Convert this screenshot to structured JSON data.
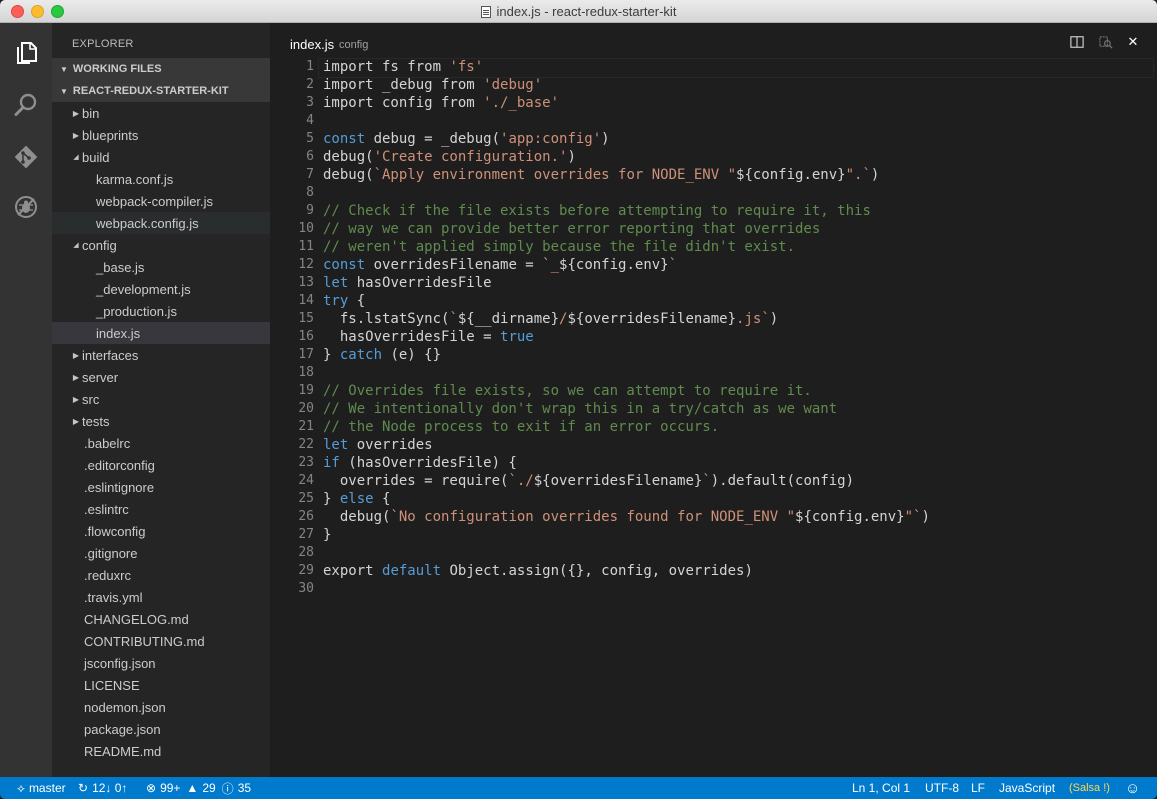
{
  "window": {
    "title": "index.js - react-redux-starter-kit"
  },
  "activity_bar": [
    {
      "name": "explorer-icon"
    },
    {
      "name": "search-icon"
    },
    {
      "name": "git-icon"
    },
    {
      "name": "debug-icon"
    }
  ],
  "sidebar": {
    "title": "EXPLORER",
    "working_files": "WORKING FILES",
    "project": "REACT-REDUX-STARTER-KIT",
    "tree": [
      {
        "label": "bin",
        "kind": "folder-collapsed",
        "depth": 1
      },
      {
        "label": "blueprints",
        "kind": "folder-collapsed",
        "depth": 1
      },
      {
        "label": "build",
        "kind": "folder-expanded",
        "depth": 1
      },
      {
        "label": "karma.conf.js",
        "kind": "file",
        "depth": 2
      },
      {
        "label": "webpack-compiler.js",
        "kind": "file",
        "depth": 2
      },
      {
        "label": "webpack.config.js",
        "kind": "file",
        "depth": 2,
        "state": "hover"
      },
      {
        "label": "config",
        "kind": "folder-expanded",
        "depth": 1
      },
      {
        "label": "_base.js",
        "kind": "file",
        "depth": 2
      },
      {
        "label": "_development.js",
        "kind": "file",
        "depth": 2
      },
      {
        "label": "_production.js",
        "kind": "file",
        "depth": 2
      },
      {
        "label": "index.js",
        "kind": "file",
        "depth": 2,
        "state": "selected"
      },
      {
        "label": "interfaces",
        "kind": "folder-collapsed",
        "depth": 1
      },
      {
        "label": "server",
        "kind": "folder-collapsed",
        "depth": 1
      },
      {
        "label": "src",
        "kind": "folder-collapsed",
        "depth": 1
      },
      {
        "label": "tests",
        "kind": "folder-collapsed",
        "depth": 1
      },
      {
        "label": ".babelrc",
        "kind": "file",
        "depth": 1
      },
      {
        "label": ".editorconfig",
        "kind": "file",
        "depth": 1
      },
      {
        "label": ".eslintignore",
        "kind": "file",
        "depth": 1
      },
      {
        "label": ".eslintrc",
        "kind": "file",
        "depth": 1
      },
      {
        "label": ".flowconfig",
        "kind": "file",
        "depth": 1
      },
      {
        "label": ".gitignore",
        "kind": "file",
        "depth": 1
      },
      {
        "label": ".reduxrc",
        "kind": "file",
        "depth": 1
      },
      {
        "label": ".travis.yml",
        "kind": "file",
        "depth": 1
      },
      {
        "label": "CHANGELOG.md",
        "kind": "file",
        "depth": 1
      },
      {
        "label": "CONTRIBUTING.md",
        "kind": "file",
        "depth": 1
      },
      {
        "label": "jsconfig.json",
        "kind": "file",
        "depth": 1
      },
      {
        "label": "LICENSE",
        "kind": "file",
        "depth": 1
      },
      {
        "label": "nodemon.json",
        "kind": "file",
        "depth": 1
      },
      {
        "label": "package.json",
        "kind": "file",
        "depth": 1
      },
      {
        "label": "README.md",
        "kind": "file",
        "depth": 1
      }
    ]
  },
  "editor": {
    "tab": {
      "name": "index.js",
      "description": "config"
    },
    "actions": [
      {
        "name": "split-editor-icon",
        "glyph": "◫"
      },
      {
        "name": "open-changes-icon",
        "glyph": "⧉"
      },
      {
        "name": "close-icon",
        "glyph": "✕"
      }
    ],
    "lines": [
      [
        [
          "",
          "import fs from "
        ],
        [
          "s",
          "'fs'"
        ]
      ],
      [
        [
          "",
          "import _debug from "
        ],
        [
          "s",
          "'debug'"
        ]
      ],
      [
        [
          "",
          "import config from "
        ],
        [
          "s",
          "'./_base'"
        ]
      ],
      [],
      [
        [
          "k",
          "const"
        ],
        [
          "",
          " debug = _debug("
        ],
        [
          "s",
          "'app:config'"
        ],
        [
          "",
          ")"
        ]
      ],
      [
        [
          "",
          "debug("
        ],
        [
          "s",
          "'Create configuration.'"
        ],
        [
          "",
          ")"
        ]
      ],
      [
        [
          "",
          "debug("
        ],
        [
          "s",
          "`Apply environment overrides for NODE_ENV \""
        ],
        [
          "",
          "${config.env}"
        ],
        [
          "s",
          "\".`"
        ],
        [
          "",
          ")"
        ]
      ],
      [],
      [
        [
          "c",
          "// Check if the file exists before attempting to require it, this"
        ]
      ],
      [
        [
          "c",
          "// way we can provide better error reporting that overrides"
        ]
      ],
      [
        [
          "c",
          "// weren't applied simply because the file didn't exist."
        ]
      ],
      [
        [
          "k",
          "const"
        ],
        [
          "",
          " overridesFilename = "
        ],
        [
          "s",
          "`_"
        ],
        [
          "",
          "${config.env}"
        ],
        [
          "s",
          "`"
        ]
      ],
      [
        [
          "k",
          "let"
        ],
        [
          "",
          " hasOverridesFile"
        ]
      ],
      [
        [
          "k",
          "try"
        ],
        [
          "",
          " {"
        ]
      ],
      [
        [
          "",
          "  fs.lstatSync("
        ],
        [
          "s",
          "`"
        ],
        [
          "",
          "${__dirname}"
        ],
        [
          "s",
          "/"
        ],
        [
          "",
          "${overridesFilename}"
        ],
        [
          "s",
          ".js`"
        ],
        [
          "",
          ")"
        ]
      ],
      [
        [
          "",
          "  hasOverridesFile = "
        ],
        [
          "k",
          "true"
        ]
      ],
      [
        [
          "",
          "} "
        ],
        [
          "k",
          "catch"
        ],
        [
          "",
          " (e) {}"
        ]
      ],
      [],
      [
        [
          "c",
          "// Overrides file exists, so we can attempt to require it."
        ]
      ],
      [
        [
          "c",
          "// We intentionally don't wrap this in a try/catch as we want"
        ]
      ],
      [
        [
          "c",
          "// the Node process to exit if an error occurs."
        ]
      ],
      [
        [
          "k",
          "let"
        ],
        [
          "",
          " overrides"
        ]
      ],
      [
        [
          "k",
          "if"
        ],
        [
          "",
          " (hasOverridesFile) {"
        ]
      ],
      [
        [
          "",
          "  overrides = require("
        ],
        [
          "s",
          "`./"
        ],
        [
          "",
          "${overridesFilename}"
        ],
        [
          "s",
          "`"
        ],
        [
          "",
          ").default(config)"
        ]
      ],
      [
        [
          "",
          "} "
        ],
        [
          "k",
          "else"
        ],
        [
          "",
          " {"
        ]
      ],
      [
        [
          "",
          "  debug("
        ],
        [
          "s",
          "`No configuration overrides found for NODE_ENV \""
        ],
        [
          "",
          "${config.env}"
        ],
        [
          "s",
          "\"`"
        ],
        [
          "",
          ")"
        ]
      ],
      [
        [
          "",
          "}"
        ]
      ],
      [],
      [
        [
          "",
          "export "
        ],
        [
          "k",
          "default"
        ],
        [
          "",
          " Object.assign({}, config, overrides)"
        ]
      ],
      []
    ]
  },
  "statusbar": {
    "branch": "master",
    "sync": "12↓ 0↑",
    "errors": "99+",
    "warnings": "29",
    "infos": "35",
    "position": "Ln 1, Col 1",
    "encoding": "UTF-8",
    "eol": "LF",
    "language": "JavaScript",
    "linter": "(Salsa !)",
    "smiley": "☺"
  },
  "colors": {
    "statusbar_bg": "#007acc",
    "keyword": "#569cd6",
    "string": "#ce9178",
    "comment": "#608b4e",
    "sidebar_bg": "#252526",
    "activitybar_bg": "#333333",
    "editor_bg": "#1e1e1e"
  }
}
